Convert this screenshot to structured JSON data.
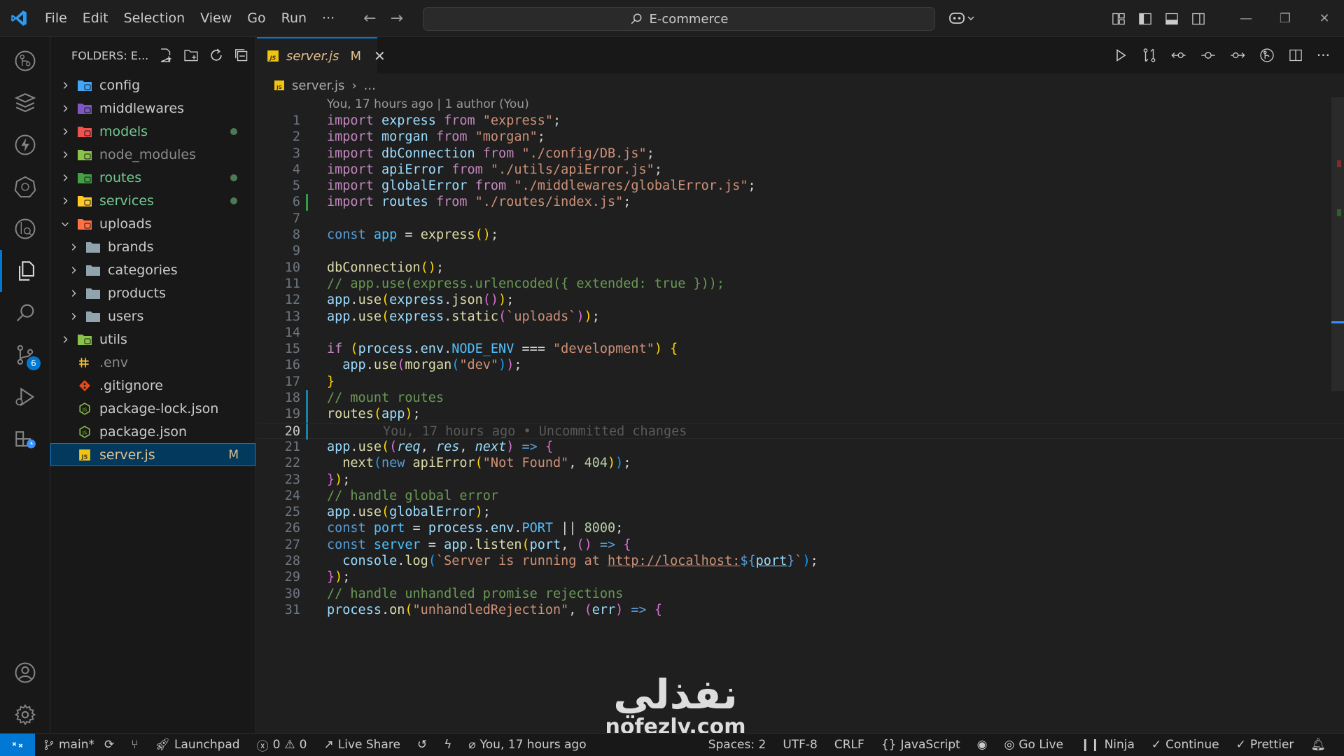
{
  "menu": [
    "File",
    "Edit",
    "Selection",
    "View",
    "Go",
    "Run",
    "···"
  ],
  "command_center": {
    "text": "E-commerce"
  },
  "sidebar": {
    "title": "FOLDERS: E...",
    "items": [
      {
        "label": "config",
        "type": "folder",
        "icon": "config-folder",
        "color": "#42a5f5",
        "expanded": false,
        "level": 0
      },
      {
        "label": "middlewares",
        "type": "folder",
        "icon": "middleware-folder",
        "color": "#7e57c2",
        "expanded": false,
        "level": 0
      },
      {
        "label": "models",
        "type": "folder",
        "icon": "models-folder",
        "color": "#ef5350",
        "expanded": false,
        "level": 0,
        "status": "dot",
        "text_color": "#73c991"
      },
      {
        "label": "node_modules",
        "type": "folder",
        "icon": "node-folder",
        "color": "#8bc34a",
        "expanded": false,
        "level": 0,
        "text_color": "#8c8c8c"
      },
      {
        "label": "routes",
        "type": "folder",
        "icon": "routes-folder",
        "color": "#43a047",
        "expanded": false,
        "level": 0,
        "status": "dot",
        "text_color": "#73c991"
      },
      {
        "label": "services",
        "type": "folder",
        "icon": "services-folder",
        "color": "#ffca28",
        "expanded": false,
        "level": 0,
        "status": "dot",
        "text_color": "#73c991"
      },
      {
        "label": "uploads",
        "type": "folder",
        "icon": "uploads-folder",
        "color": "#ff7043",
        "expanded": true,
        "level": 0
      },
      {
        "label": "brands",
        "type": "folder",
        "icon": "folder",
        "color": "#90a4ae",
        "expanded": false,
        "level": 1
      },
      {
        "label": "categories",
        "type": "folder",
        "icon": "folder",
        "color": "#90a4ae",
        "expanded": false,
        "level": 1
      },
      {
        "label": "products",
        "type": "folder",
        "icon": "folder",
        "color": "#90a4ae",
        "expanded": false,
        "level": 1
      },
      {
        "label": "users",
        "type": "folder",
        "icon": "folder",
        "color": "#90a4ae",
        "expanded": false,
        "level": 1
      },
      {
        "label": "utils",
        "type": "folder",
        "icon": "utils-folder",
        "color": "#8bc34a",
        "expanded": false,
        "level": 0
      },
      {
        "label": ".env",
        "type": "file",
        "icon": "env-file",
        "color": "#fbc02d",
        "level": 0,
        "text_color": "#8c8c8c"
      },
      {
        "label": ".gitignore",
        "type": "file",
        "icon": "git-file",
        "color": "#e64a19",
        "level": 0
      },
      {
        "label": "package-lock.json",
        "type": "file",
        "icon": "node-file",
        "color": "#8bc34a",
        "level": 0
      },
      {
        "label": "package.json",
        "type": "file",
        "icon": "node-file",
        "color": "#8bc34a",
        "level": 0
      },
      {
        "label": "server.js",
        "type": "file",
        "icon": "js-file",
        "color": "#ffca28",
        "level": 0,
        "status": "M",
        "selected": true
      }
    ]
  },
  "tab": {
    "label": "server.js",
    "modified": "M"
  },
  "breadcrumb": {
    "file": "server.js",
    "rest": "..."
  },
  "codelens": "You, 17 hours ago | 1 author (You)",
  "current_line": 20,
  "ghost_blame": "You, 17 hours ago • Uncommitted changes",
  "code_lines": [
    [
      [
        "k",
        "import"
      ],
      [
        "p",
        " "
      ],
      [
        "v",
        "express"
      ],
      [
        "p",
        " "
      ],
      [
        "k",
        "from"
      ],
      [
        "p",
        " "
      ],
      [
        "s",
        "\"express\""
      ],
      [
        "p",
        ";"
      ]
    ],
    [
      [
        "k",
        "import"
      ],
      [
        "p",
        " "
      ],
      [
        "v",
        "morgan"
      ],
      [
        "p",
        " "
      ],
      [
        "k",
        "from"
      ],
      [
        "p",
        " "
      ],
      [
        "s",
        "\"morgan\""
      ],
      [
        "p",
        ";"
      ]
    ],
    [
      [
        "k",
        "import"
      ],
      [
        "p",
        " "
      ],
      [
        "v",
        "dbConnection"
      ],
      [
        "p",
        " "
      ],
      [
        "k",
        "from"
      ],
      [
        "p",
        " "
      ],
      [
        "s",
        "\"./config/DB.js\""
      ],
      [
        "p",
        ";"
      ]
    ],
    [
      [
        "k",
        "import"
      ],
      [
        "p",
        " "
      ],
      [
        "v",
        "apiError"
      ],
      [
        "p",
        " "
      ],
      [
        "k",
        "from"
      ],
      [
        "p",
        " "
      ],
      [
        "s",
        "\"./utils/apiError.js\""
      ],
      [
        "p",
        ";"
      ]
    ],
    [
      [
        "k",
        "import"
      ],
      [
        "p",
        " "
      ],
      [
        "v",
        "globalError"
      ],
      [
        "p",
        " "
      ],
      [
        "k",
        "from"
      ],
      [
        "p",
        " "
      ],
      [
        "s",
        "\"./middlewares/globalError.js\""
      ],
      [
        "p",
        ";"
      ]
    ],
    [
      [
        "k",
        "import"
      ],
      [
        "p",
        " "
      ],
      [
        "v",
        "routes"
      ],
      [
        "p",
        " "
      ],
      [
        "k",
        "from"
      ],
      [
        "p",
        " "
      ],
      [
        "s",
        "\"./routes/index.js\""
      ],
      [
        "p",
        ";"
      ]
    ],
    [],
    [
      [
        "kb",
        "const"
      ],
      [
        "p",
        " "
      ],
      [
        "c2",
        "app"
      ],
      [
        "p",
        " = "
      ],
      [
        "f",
        "express"
      ],
      [
        "b1",
        "()"
      ],
      [
        "p",
        ";"
      ]
    ],
    [],
    [
      [
        "f",
        "dbConnection"
      ],
      [
        "b1",
        "()"
      ],
      [
        "p",
        ";"
      ]
    ],
    [
      [
        "cm",
        "// app.use(express.urlencoded({ extended: true }));"
      ]
    ],
    [
      [
        "v",
        "app"
      ],
      [
        "p",
        "."
      ],
      [
        "f",
        "use"
      ],
      [
        "b1",
        "("
      ],
      [
        "v",
        "express"
      ],
      [
        "p",
        "."
      ],
      [
        "f",
        "json"
      ],
      [
        "b2",
        "()"
      ],
      [
        "b1",
        ")"
      ],
      [
        "p",
        ";"
      ]
    ],
    [
      [
        "v",
        "app"
      ],
      [
        "p",
        "."
      ],
      [
        "f",
        "use"
      ],
      [
        "b1",
        "("
      ],
      [
        "v",
        "express"
      ],
      [
        "p",
        "."
      ],
      [
        "f",
        "static"
      ],
      [
        "b2",
        "("
      ],
      [
        "s",
        "`uploads`"
      ],
      [
        "b2",
        ")"
      ],
      [
        "b1",
        ")"
      ],
      [
        "p",
        ";"
      ]
    ],
    [],
    [
      [
        "k",
        "if"
      ],
      [
        "p",
        " "
      ],
      [
        "b1",
        "("
      ],
      [
        "v",
        "process"
      ],
      [
        "p",
        "."
      ],
      [
        "v",
        "env"
      ],
      [
        "p",
        "."
      ],
      [
        "c2",
        "NODE_ENV"
      ],
      [
        "p",
        " === "
      ],
      [
        "s",
        "\"development\""
      ],
      [
        "b1",
        ")"
      ],
      [
        "p",
        " "
      ],
      [
        "b1",
        "{"
      ]
    ],
    [
      [
        "p",
        "  "
      ],
      [
        "v",
        "app"
      ],
      [
        "p",
        "."
      ],
      [
        "f",
        "use"
      ],
      [
        "b2",
        "("
      ],
      [
        "f",
        "morgan"
      ],
      [
        "b3",
        "("
      ],
      [
        "s",
        "\"dev\""
      ],
      [
        "b3",
        ")"
      ],
      [
        "b2",
        ")"
      ],
      [
        "p",
        ";"
      ]
    ],
    [
      [
        "b1",
        "}"
      ]
    ],
    [
      [
        "cm",
        "// mount routes"
      ]
    ],
    [
      [
        "f",
        "routes"
      ],
      [
        "b1",
        "("
      ],
      [
        "v",
        "app"
      ],
      [
        "b1",
        ")"
      ],
      [
        "p",
        ";"
      ]
    ],
    [],
    [
      [
        "v",
        "app"
      ],
      [
        "p",
        "."
      ],
      [
        "f",
        "use"
      ],
      [
        "b1",
        "("
      ],
      [
        "b2",
        "("
      ],
      [
        "v it",
        "req"
      ],
      [
        "p",
        ", "
      ],
      [
        "v it",
        "res"
      ],
      [
        "p",
        ", "
      ],
      [
        "v it",
        "next"
      ],
      [
        "b2",
        ")"
      ],
      [
        "p",
        " "
      ],
      [
        "kb",
        "=>"
      ],
      [
        "p",
        " "
      ],
      [
        "b2",
        "{"
      ]
    ],
    [
      [
        "p",
        "  "
      ],
      [
        "f",
        "next"
      ],
      [
        "b3",
        "("
      ],
      [
        "kb",
        "new"
      ],
      [
        "p",
        " "
      ],
      [
        "f",
        "apiError"
      ],
      [
        "b1",
        "("
      ],
      [
        "s",
        "\"Not Found\""
      ],
      [
        "p",
        ", "
      ],
      [
        "n",
        "404"
      ],
      [
        "b1",
        ")"
      ],
      [
        "b3",
        ")"
      ],
      [
        "p",
        ";"
      ]
    ],
    [
      [
        "b2",
        "}"
      ],
      [
        "b1",
        ")"
      ],
      [
        "p",
        ";"
      ]
    ],
    [
      [
        "cm",
        "// handle global error"
      ]
    ],
    [
      [
        "v",
        "app"
      ],
      [
        "p",
        "."
      ],
      [
        "f",
        "use"
      ],
      [
        "b1",
        "("
      ],
      [
        "v",
        "globalError"
      ],
      [
        "b1",
        ")"
      ],
      [
        "p",
        ";"
      ]
    ],
    [
      [
        "kb",
        "const"
      ],
      [
        "p",
        " "
      ],
      [
        "c2",
        "port"
      ],
      [
        "p",
        " = "
      ],
      [
        "v",
        "process"
      ],
      [
        "p",
        "."
      ],
      [
        "v",
        "env"
      ],
      [
        "p",
        "."
      ],
      [
        "c2",
        "PORT"
      ],
      [
        "p",
        " || "
      ],
      [
        "n",
        "8000"
      ],
      [
        "p",
        ";"
      ]
    ],
    [
      [
        "kb",
        "const"
      ],
      [
        "p",
        " "
      ],
      [
        "c2",
        "server"
      ],
      [
        "p",
        " = "
      ],
      [
        "v",
        "app"
      ],
      [
        "p",
        "."
      ],
      [
        "f",
        "listen"
      ],
      [
        "b1",
        "("
      ],
      [
        "v",
        "port"
      ],
      [
        "p",
        ", "
      ],
      [
        "b2",
        "()"
      ],
      [
        "p",
        " "
      ],
      [
        "kb",
        "=>"
      ],
      [
        "p",
        " "
      ],
      [
        "b2",
        "{"
      ]
    ],
    [
      [
        "p",
        "  "
      ],
      [
        "v",
        "console"
      ],
      [
        "p",
        "."
      ],
      [
        "f",
        "log"
      ],
      [
        "b3",
        "("
      ],
      [
        "s",
        "`Server is running at "
      ],
      [
        "s ul",
        "http://localhost:"
      ],
      [
        "kb",
        "${"
      ],
      [
        "v ul",
        "port"
      ],
      [
        "kb",
        "}"
      ],
      [
        "s",
        "`"
      ],
      [
        "b3",
        ")"
      ],
      [
        "p",
        ";"
      ]
    ],
    [
      [
        "b2",
        "}"
      ],
      [
        "b1",
        ")"
      ],
      [
        "p",
        ";"
      ]
    ],
    [
      [
        "cm",
        "// handle unhandled promise rejections"
      ]
    ],
    [
      [
        "v",
        "process"
      ],
      [
        "p",
        "."
      ],
      [
        "f",
        "on"
      ],
      [
        "b1",
        "("
      ],
      [
        "s",
        "\"unhandledRejection\""
      ],
      [
        "p",
        ", "
      ],
      [
        "b2",
        "("
      ],
      [
        "v",
        "err"
      ],
      [
        "b2",
        ")"
      ],
      [
        "p",
        " "
      ],
      [
        "kb",
        "=>"
      ],
      [
        "p",
        " "
      ],
      [
        "b2",
        "{"
      ]
    ]
  ],
  "gutter_marks": {
    "6": "#2ea043",
    "18": "#1b81a8",
    "19": "#1b81a8",
    "20": "#1b81a8"
  },
  "statusbar": {
    "branch": "main*",
    "launchpad": "Launchpad",
    "errors": "0",
    "warnings": "0",
    "live_share": "Live Share",
    "blame": "You, 17 hours ago",
    "spaces": "Spaces: 2",
    "encoding": "UTF-8",
    "eol": "CRLF",
    "language": "JavaScript",
    "go_live": "Go Live",
    "ninja": "Ninja",
    "continue": "Continue",
    "prettier": "Prettier"
  },
  "scm_badge": "6",
  "watermark": {
    "arabic": "نفذلي",
    "latin": "nofezly.com"
  },
  "colors": {
    "accent": "#0078d4",
    "modified": "#e2c08d",
    "added": "#73c991"
  }
}
